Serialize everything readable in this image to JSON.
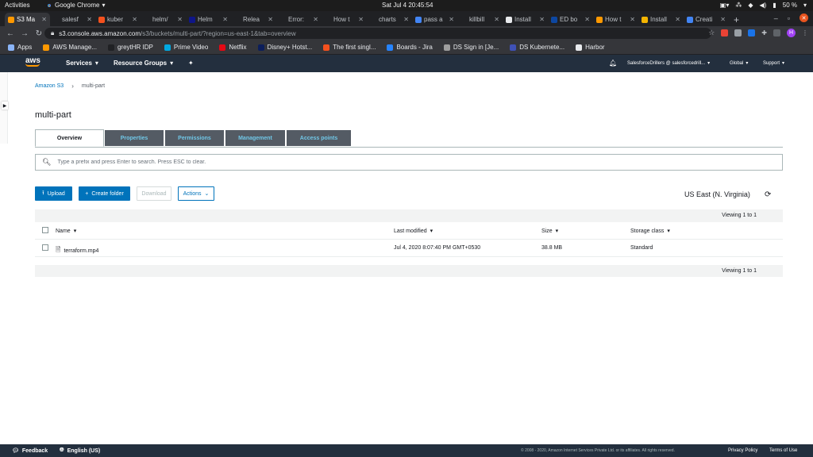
{
  "os_bar": {
    "activities": "Activities",
    "app_name": "Google Chrome",
    "clock": "Sat Jul 4  20:45:54",
    "battery": "50 %"
  },
  "browser": {
    "tabs": [
      {
        "label": "S3 Ma",
        "active": true,
        "favicon_color": "#ff9900"
      },
      {
        "label": "salesf",
        "favicon_color": "#202124"
      },
      {
        "label": "kuber",
        "favicon_color": "#f4511e"
      },
      {
        "label": "helm/",
        "favicon_color": "#202124"
      },
      {
        "label": "Helm",
        "favicon_color": "#0f1689"
      },
      {
        "label": "Relea",
        "favicon_color": "#202124"
      },
      {
        "label": "Error:",
        "favicon_color": "#202124"
      },
      {
        "label": "How t",
        "favicon_color": "#202124"
      },
      {
        "label": "charts",
        "favicon_color": "#202124"
      },
      {
        "label": "pass a",
        "favicon_color": "#4285f4"
      },
      {
        "label": "killbill",
        "favicon_color": "#202124"
      },
      {
        "label": "Install",
        "favicon_color": "#e8eaed"
      },
      {
        "label": "ED bo",
        "favicon_color": "#0d47a1"
      },
      {
        "label": "How t",
        "favicon_color": "#ff9900"
      },
      {
        "label": "Install",
        "favicon_color": "#f4b400"
      },
      {
        "label": "Creati",
        "favicon_color": "#4285f4"
      }
    ],
    "url_host": "s3.console.aws.amazon.com",
    "url_path": "/s3/buckets/multi-part/?region=us-east-1&tab=overview",
    "profile_initial": "H",
    "bookmarks": [
      {
        "label": "Apps",
        "color": "#8ab4f8"
      },
      {
        "label": "AWS Manage...",
        "color": "#ff9900"
      },
      {
        "label": "greytHR IDP",
        "color": "#202124"
      },
      {
        "label": "Prime Video",
        "color": "#00a8e1"
      },
      {
        "label": "Netflix",
        "color": "#e50914"
      },
      {
        "label": "Disney+ Hotst...",
        "color": "#0c1e5b"
      },
      {
        "label": "The first singl...",
        "color": "#f4511e"
      },
      {
        "label": "Boards - Jira",
        "color": "#2684ff"
      },
      {
        "label": "DS Sign in [Je...",
        "color": "#9e9e9e"
      },
      {
        "label": "DS Kubernete...",
        "color": "#3f51b5"
      },
      {
        "label": "Harbor",
        "color": "#e8eaed"
      }
    ]
  },
  "aws_nav": {
    "logo": "aws",
    "services": "Services",
    "resource_groups": "Resource Groups",
    "account": "SalesforceDrillers @ salesforcedrill...",
    "region": "Global",
    "support": "Support"
  },
  "breadcrumb": {
    "root": "Amazon S3",
    "current": "multi-part"
  },
  "page_title": "multi-part",
  "tabs": [
    {
      "label": "Overview",
      "active": true
    },
    {
      "label": "Properties"
    },
    {
      "label": "Permissions"
    },
    {
      "label": "Management"
    },
    {
      "label": "Access points"
    }
  ],
  "search": {
    "placeholder": "Type a prefix and press Enter to search. Press ESC to clear."
  },
  "actions": {
    "upload": "Upload",
    "create_folder": "Create folder",
    "download": "Download",
    "actions": "Actions"
  },
  "region_label": "US East (N. Virginia)",
  "table": {
    "viewing_top": "Viewing 1 to 1",
    "viewing_bottom": "Viewing 1 to 1",
    "headers": {
      "name": "Name",
      "modified": "Last modified",
      "size": "Size",
      "storage": "Storage class"
    },
    "rows": [
      {
        "name": "terraform.mp4",
        "modified": "Jul 4, 2020 8:07:40 PM GMT+0530",
        "size": "38.8 MB",
        "storage": "Standard"
      }
    ]
  },
  "footer": {
    "feedback": "Feedback",
    "language": "English (US)",
    "copyright": "© 2008 - 2020, Amazon Internet Services Private Ltd. or its affiliates. All rights reserved.",
    "privacy": "Privacy Policy",
    "terms": "Terms of Use"
  }
}
